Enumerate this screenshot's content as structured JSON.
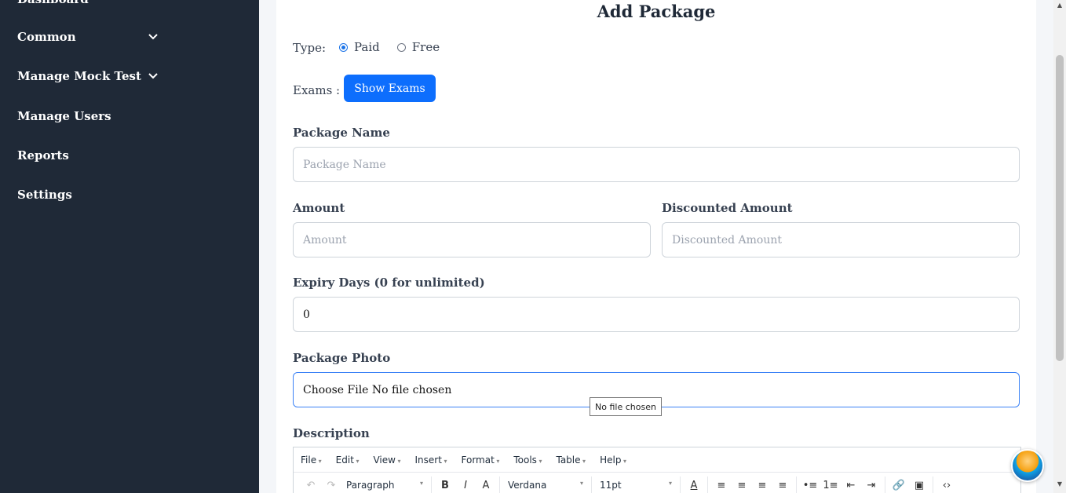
{
  "sidebar": {
    "partial_item": "Dashboard",
    "items": [
      {
        "label": "Common",
        "has_children": true
      },
      {
        "label": "Manage Mock Test",
        "has_children": true
      },
      {
        "label": "Manage Users",
        "has_children": false
      },
      {
        "label": "Reports",
        "has_children": false
      },
      {
        "label": "Settings",
        "has_children": false
      }
    ]
  },
  "form": {
    "title": "Add Package",
    "type_label": "Type:",
    "type_options": [
      "Paid",
      "Free"
    ],
    "type_selected": "Paid",
    "exams_label": "Exams :",
    "show_exams_button": "Show Exams",
    "package_name_label": "Package Name",
    "package_name_placeholder": "Package Name",
    "amount_label": "Amount",
    "amount_placeholder": "Amount",
    "discounted_amount_label": "Discounted Amount",
    "discounted_amount_placeholder": "Discounted Amount",
    "expiry_label": "Expiry Days (0 for unlimited)",
    "expiry_value": "0",
    "photo_label": "Package Photo",
    "photo_value": "Choose File No file chosen",
    "photo_tooltip": "No file chosen",
    "description_label": "Description"
  },
  "editor": {
    "menu": [
      "File",
      "Edit",
      "View",
      "Insert",
      "Format",
      "Tools",
      "Table",
      "Help"
    ],
    "block_format": "Paragraph",
    "font_family": "Verdana",
    "font_size": "11pt"
  },
  "colors": {
    "sidebar_bg": "#1f2937",
    "primary": "#0d6efd"
  }
}
